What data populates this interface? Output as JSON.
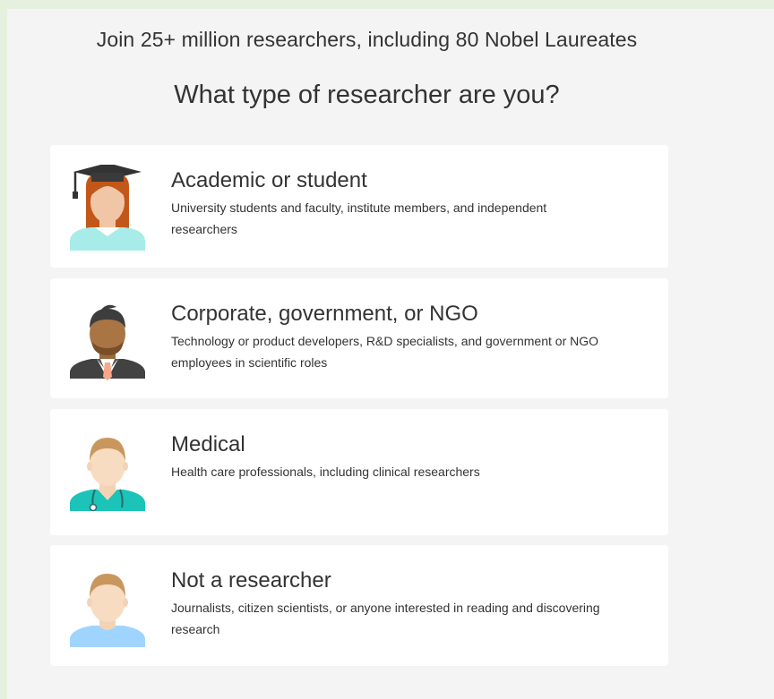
{
  "tagline": "Join 25+ million researchers, including 80 Nobel Laureates",
  "question": "What type of researcher are you?",
  "options": [
    {
      "title": "Academic or student",
      "description": "University students and faculty, institute members, and independent researchers",
      "icon": "graduate-avatar-icon"
    },
    {
      "title": "Corporate, government, or NGO",
      "description": "Technology or product developers, R&D specialists, and government or NGO employees in scientific roles",
      "icon": "business-avatar-icon"
    },
    {
      "title": "Medical",
      "description": "Health care professionals, including clinical researchers",
      "icon": "doctor-avatar-icon"
    },
    {
      "title": "Not a researcher",
      "description": "Journalists, citizen scientists, or anyone interested in reading and discovering research",
      "icon": "person-avatar-icon"
    }
  ]
}
